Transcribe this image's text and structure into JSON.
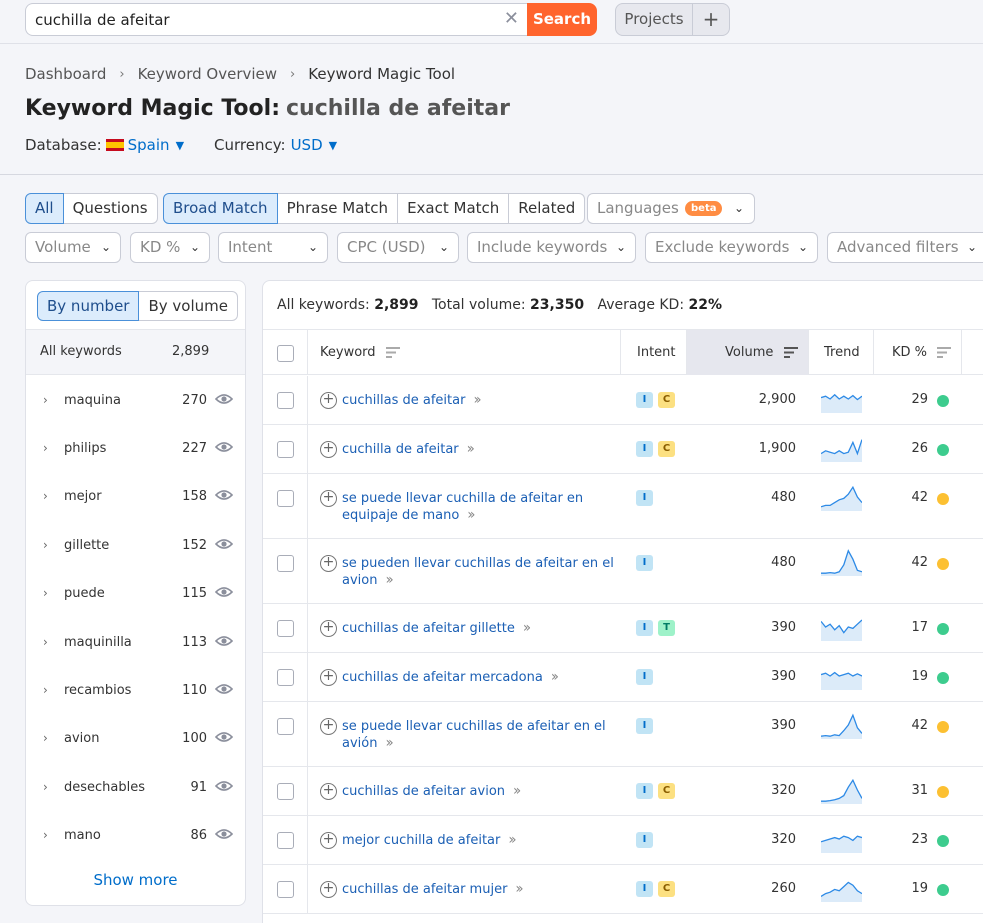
{
  "search": {
    "value": "cuchilla de afeitar",
    "clear": "✕",
    "button": "Search"
  },
  "top": {
    "projects": "Projects",
    "plus": "+"
  },
  "breadcrumb": [
    "Dashboard",
    "Keyword Overview",
    "Keyword Magic Tool"
  ],
  "title": {
    "tool": "Keyword Magic Tool:",
    "keyword": "cuchilla de afeitar"
  },
  "database": {
    "label": "Database:",
    "value": "Spain",
    "currency_label": "Currency:",
    "currency": "USD"
  },
  "tabs1": [
    "All",
    "Questions"
  ],
  "tabs2": [
    "Broad Match",
    "Phrase Match",
    "Exact Match",
    "Related"
  ],
  "languages": {
    "label": "Languages",
    "badge": "beta"
  },
  "filters": [
    "Volume",
    "KD %",
    "Intent",
    "CPC (USD)",
    "Include keywords",
    "Exclude keywords",
    "Advanced filters"
  ],
  "left": {
    "toggle": [
      "By number",
      "By volume"
    ],
    "all_label": "All keywords",
    "all_count": "2,899",
    "groups": [
      {
        "label": "maquina",
        "count": "270"
      },
      {
        "label": "philips",
        "count": "227"
      },
      {
        "label": "mejor",
        "count": "158"
      },
      {
        "label": "gillette",
        "count": "152"
      },
      {
        "label": "puede",
        "count": "115"
      },
      {
        "label": "maquinilla",
        "count": "113"
      },
      {
        "label": "recambios",
        "count": "110"
      },
      {
        "label": "avion",
        "count": "100"
      },
      {
        "label": "desechables",
        "count": "91"
      },
      {
        "label": "mano",
        "count": "86"
      }
    ],
    "show_more": "Show more"
  },
  "stats": {
    "all_label": "All keywords:",
    "all": "2,899",
    "vol_label": "Total volume:",
    "vol": "23,350",
    "kd_label": "Average KD:",
    "kd": "22%"
  },
  "columns": {
    "keyword": "Keyword",
    "intent": "Intent",
    "volume": "Volume",
    "trend": "Trend",
    "kd": "KD %"
  },
  "rows": [
    {
      "kw": "cuchillas de afeitar",
      "intent": [
        "I",
        "C"
      ],
      "volume": "2,900",
      "kd": "29",
      "kd_color": "#3dcc8e",
      "trend": [
        0.55,
        0.6,
        0.5,
        0.65,
        0.5,
        0.6,
        0.5,
        0.62,
        0.48,
        0.6
      ]
    },
    {
      "kw": "cuchilla de afeitar",
      "intent": [
        "I",
        "C"
      ],
      "volume": "1,900",
      "kd": "26",
      "kd_color": "#3dcc8e",
      "trend": [
        0.3,
        0.4,
        0.35,
        0.3,
        0.4,
        0.3,
        0.35,
        0.7,
        0.3,
        0.8
      ]
    },
    {
      "kw": "se puede llevar cuchilla de afeitar en equipaje de mano",
      "intent": [
        "I"
      ],
      "volume": "480",
      "kd": "42",
      "kd_color": "#fcc032",
      "trend": [
        0.15,
        0.2,
        0.2,
        0.3,
        0.4,
        0.45,
        0.6,
        0.85,
        0.5,
        0.3
      ]
    },
    {
      "kw": "se pueden llevar cuchillas de afeitar en el avion",
      "intent": [
        "I"
      ],
      "volume": "480",
      "kd": "42",
      "kd_color": "#fcc032",
      "trend": [
        0.1,
        0.1,
        0.12,
        0.1,
        0.15,
        0.4,
        0.9,
        0.6,
        0.2,
        0.15
      ]
    },
    {
      "kw": "cuchillas de afeitar gillette",
      "intent": [
        "I",
        "T"
      ],
      "volume": "390",
      "kd": "17",
      "kd_color": "#3dcc8e",
      "trend": [
        0.7,
        0.5,
        0.6,
        0.4,
        0.55,
        0.3,
        0.5,
        0.45,
        0.6,
        0.75
      ]
    },
    {
      "kw": "cuchillas de afeitar mercadona",
      "intent": [
        "I"
      ],
      "volume": "390",
      "kd": "19",
      "kd_color": "#3dcc8e",
      "trend": [
        0.55,
        0.6,
        0.5,
        0.62,
        0.5,
        0.55,
        0.6,
        0.5,
        0.58,
        0.5
      ]
    },
    {
      "kw": "se puede llevar cuchillas de afeitar en el avión",
      "intent": [
        "I"
      ],
      "volume": "390",
      "kd": "42",
      "kd_color": "#fcc032",
      "trend": [
        0.1,
        0.12,
        0.1,
        0.15,
        0.12,
        0.3,
        0.5,
        0.85,
        0.4,
        0.2
      ]
    },
    {
      "kw": "cuchillas de afeitar avion",
      "intent": [
        "I",
        "C"
      ],
      "volume": "320",
      "kd": "31",
      "kd_color": "#fcc032",
      "trend": [
        0.1,
        0.1,
        0.12,
        0.15,
        0.2,
        0.3,
        0.6,
        0.85,
        0.5,
        0.2
      ]
    },
    {
      "kw": "mejor cuchilla de afeitar",
      "intent": [
        "I"
      ],
      "volume": "320",
      "kd": "23",
      "kd_color": "#3dcc8e",
      "trend": [
        0.4,
        0.45,
        0.5,
        0.55,
        0.5,
        0.6,
        0.55,
        0.45,
        0.6,
        0.55
      ]
    },
    {
      "kw": "cuchillas de afeitar mujer",
      "intent": [
        "I",
        "C"
      ],
      "volume": "260",
      "kd": "19",
      "kd_color": "#3dcc8e",
      "trend": [
        0.2,
        0.3,
        0.35,
        0.45,
        0.4,
        0.55,
        0.7,
        0.6,
        0.4,
        0.3
      ]
    }
  ]
}
